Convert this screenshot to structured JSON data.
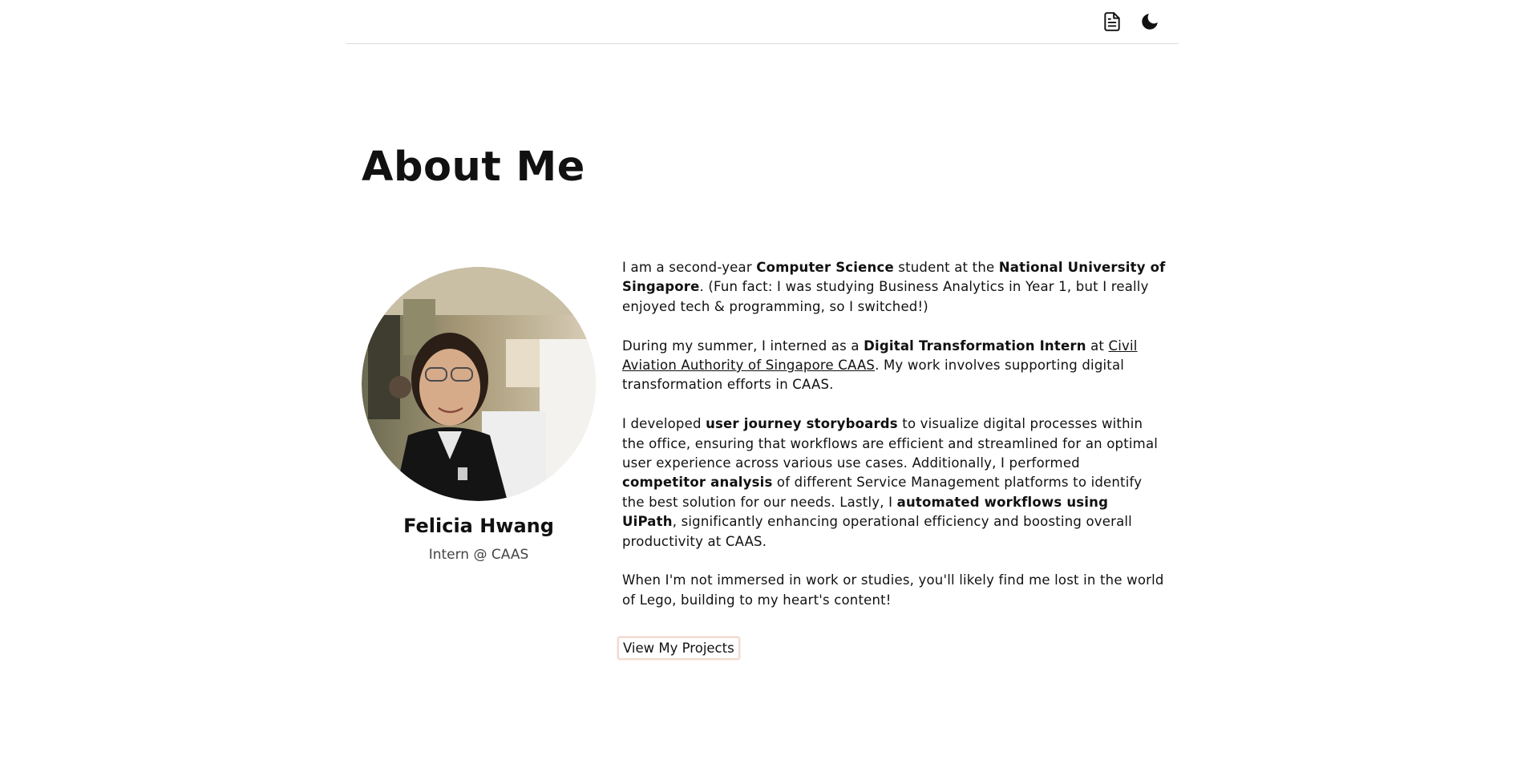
{
  "header": {
    "resume_icon": "document-icon",
    "theme_icon": "moon-icon"
  },
  "about": {
    "title": "About Me"
  },
  "profile": {
    "name": "Felicia Hwang",
    "role": "Intern @ CAAS"
  },
  "bio": {
    "p1": {
      "t1": "I am a second-year ",
      "b1": "Computer Science",
      "t2": " student at the ",
      "b2": "National University of Singapore",
      "t3": ". (Fun fact: I was studying Business Analytics in Year 1, but I really enjoyed tech & programming, so I switched!)"
    },
    "p2": {
      "t1": "During my summer, I interned as a ",
      "b1": "Digital Transformation Intern",
      "t2": " at ",
      "link": "Civil Aviation Authority of Singapore CAAS",
      "t3": ". My work involves supporting digital transformation efforts in CAAS."
    },
    "p3": {
      "t1": "I developed ",
      "b1": "user journey storyboards",
      "t2": " to visualize digital processes within the office, ensuring that workflows are efficient and streamlined for an optimal user experience across various use cases. Additionally, I performed ",
      "b2": "competitor analysis",
      "t3": " of different Service Management platforms to identify the best solution for our needs. Lastly, I ",
      "b3": "automated workflows using UiPath",
      "t4": ", significantly enhancing operational efficiency and boosting overall productivity at CAAS."
    },
    "p4": "When I'm not immersed in work or studies, you'll likely find me lost in the world of Lego, building to my heart's content!"
  },
  "cta": {
    "label": "View My Projects"
  }
}
